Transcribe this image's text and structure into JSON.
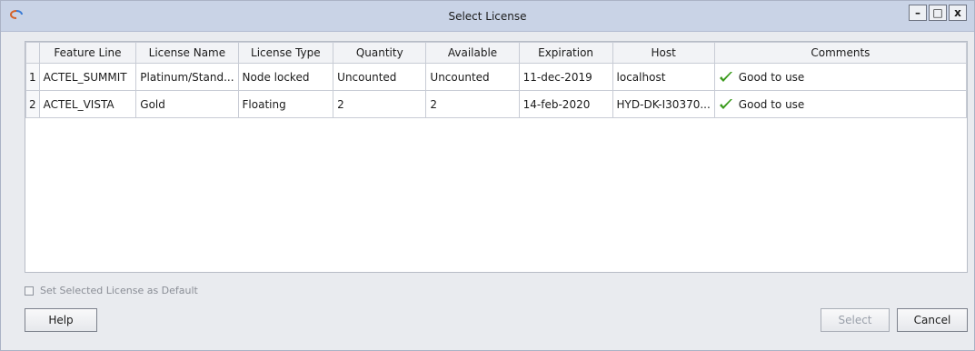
{
  "window": {
    "title": "Select License"
  },
  "controls": {
    "minimize": "–",
    "maximize": "□",
    "close": "x"
  },
  "table": {
    "columns": [
      "Feature Line",
      "License Name",
      "License Type",
      "Quantity",
      "Available",
      "Expiration",
      "Host",
      "Comments"
    ],
    "rows": [
      {
        "num": "1",
        "feature_line": "ACTEL_SUMMIT",
        "license_name": "Platinum/Stand...",
        "license_type": "Node locked",
        "quantity": "Uncounted",
        "available": "Uncounted",
        "expiration": "11-dec-2019",
        "host": "localhost",
        "comment": "Good to use"
      },
      {
        "num": "2",
        "feature_line": "ACTEL_VISTA",
        "license_name": "Gold",
        "license_type": "Floating",
        "quantity": "2",
        "available": "2",
        "expiration": "14-feb-2020",
        "host": "HYD-DK-I30370...",
        "comment": "Good to use"
      }
    ]
  },
  "default_checkbox": {
    "label": "Set Selected License as Default",
    "checked": false
  },
  "buttons": {
    "help": "Help",
    "select": "Select",
    "cancel": "Cancel"
  },
  "colors": {
    "check_green": "#3a9a1c",
    "titlebar": "#c9d3e6"
  },
  "icons": {
    "app": "app-logo-icon",
    "check": "check-icon"
  }
}
